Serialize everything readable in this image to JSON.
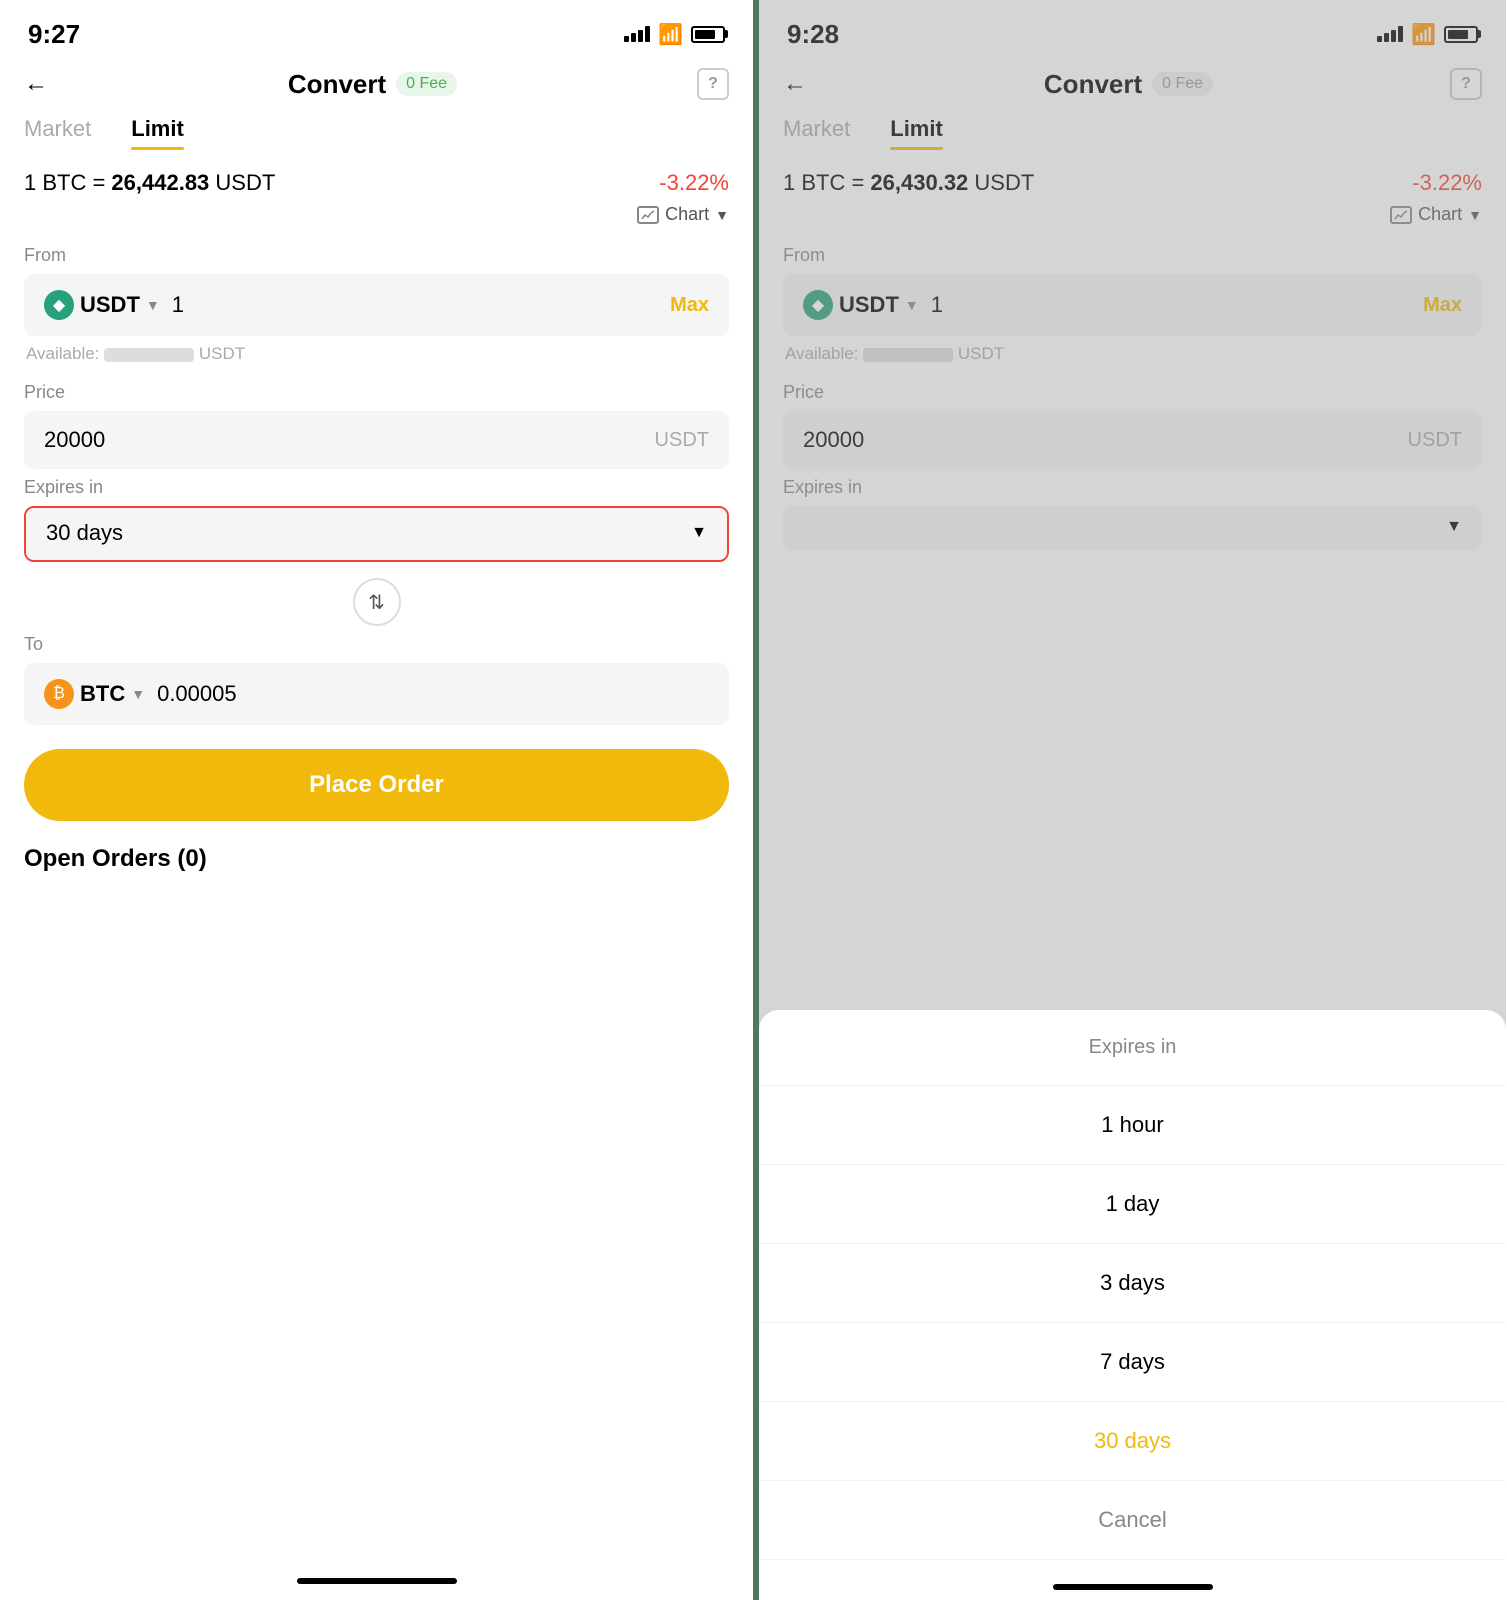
{
  "left_panel": {
    "time": "9:27",
    "header": {
      "title": "Convert",
      "fee_label": "0 Fee",
      "help_label": "?"
    },
    "tabs": [
      {
        "label": "Market",
        "active": false
      },
      {
        "label": "Limit",
        "active": true
      }
    ],
    "rate": {
      "text": "1 BTC = 26,442.83 USDT",
      "change": "-3.22%"
    },
    "chart_toggle": "Chart",
    "from_label": "From",
    "from_currency": "USDT",
    "from_value": "1",
    "max_label": "Max",
    "available_label": "Available:",
    "available_currency": "USDT",
    "price_label": "Price",
    "price_value": "20000",
    "price_currency": "USDT",
    "expires_label": "Expires in",
    "expires_value": "30 days",
    "to_label": "To",
    "to_currency": "BTC",
    "to_value": "0.00005",
    "place_order_label": "Place Order",
    "open_orders_label": "Open Orders (0)"
  },
  "right_panel": {
    "time": "9:28",
    "header": {
      "title": "Convert",
      "fee_label": "0 Fee",
      "help_label": "?"
    },
    "tabs": [
      {
        "label": "Market",
        "active": false
      },
      {
        "label": "Limit",
        "active": true
      }
    ],
    "rate": {
      "text": "1 BTC = 26,430.32 USDT",
      "change": "-3.22%"
    },
    "chart_toggle": "Chart",
    "from_label": "From",
    "from_currency": "USDT",
    "from_value": "1",
    "max_label": "Max",
    "available_label": "Available:",
    "available_currency": "USDT",
    "price_label": "Price",
    "price_value": "20000",
    "price_currency": "USDT",
    "expires_label": "Expires in",
    "bottom_sheet": {
      "header": "Expires in",
      "options": [
        {
          "label": "1 hour",
          "selected": false
        },
        {
          "label": "1 day",
          "selected": false
        },
        {
          "label": "3 days",
          "selected": false
        },
        {
          "label": "7 days",
          "selected": false
        },
        {
          "label": "30 days",
          "selected": true
        },
        {
          "label": "Cancel",
          "is_cancel": true
        }
      ]
    }
  }
}
